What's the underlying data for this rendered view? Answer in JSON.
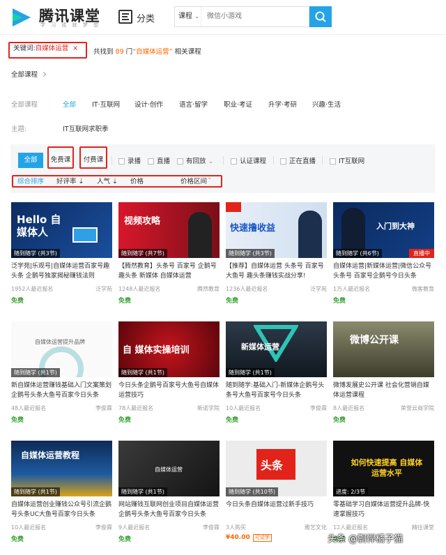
{
  "header": {
    "brand": "腾讯课堂",
    "slogan": "学 习 成 就 梦 想",
    "category_label": "分类",
    "search_type": "课程",
    "search_placeholder": "微信小游戏"
  },
  "keyword_chip": {
    "prefix": "关键词:",
    "value": "自媒体运营",
    "close": "×"
  },
  "result": {
    "pre": "共找到",
    "count": "89",
    "mid": "门",
    "query": "“自媒体运营”",
    "post": "相关课程"
  },
  "all_courses": "全部课程",
  "filters": {
    "category_key": "全部课程",
    "categories": [
      "全部",
      "IT·互联网",
      "设计·创作",
      "语言·留学",
      "职业·考证",
      "升学·考研",
      "兴趣·生活"
    ],
    "topic_key": "主题:",
    "topic_value": "IT互联网求职季"
  },
  "price_tabs": [
    "全部",
    "免费课",
    "付费课"
  ],
  "checkboxes": [
    "录播",
    "直播",
    "有回放",
    "认证课程",
    "正在直播",
    "IT互联网"
  ],
  "sort": [
    "综合排序",
    "好评率 ⇣",
    "人气 ⇣",
    "价格",
    "价格区间"
  ],
  "courses": [
    {
      "thumb": "Hello 自媒体人",
      "tag": "随到随学 (共3节)",
      "name": "泛学苑|乐观号|自媒体运营百家号趣头条 企鹅号独家揭秘赚钱法则",
      "count": "1952人最近报名",
      "org": "泛学苑",
      "price": "免费",
      "live": ""
    },
    {
      "thumb": "视频攻略",
      "tag": "随到随学 (共7节)",
      "name": "【腾然教育】头条号 百家号 企鹅号 趣头条 新媒体 自媒体运营",
      "count": "1248人最近报名",
      "org": "腾然教育",
      "price": "免费",
      "live": ""
    },
    {
      "thumb": "快速撸收益",
      "tag": "随到随学 (共3节)",
      "name": "【推荐】自媒体运营 头条号 百家号 大鱼号 趣头条赚钱实战分享!",
      "count": "1236人最近报名",
      "org": "泛学苑",
      "price": "免费",
      "live": ""
    },
    {
      "thumb": "入门到大神",
      "tag": "随到随学 (共6节)",
      "name": "自媒体运营|新媒体运营|微信公众号 头条号 百家号企鹅号今日头条",
      "count": "1万人最近报名",
      "org": "微客教育",
      "price": "免费",
      "live": "直播中"
    },
    {
      "thumb": "自媒体运营提升品牌",
      "tag": "随到随学 (共1节)",
      "name": "新自媒体运营赚钱基础入门文案策划企鹅号头条大鱼号百家今日头条",
      "count": "48人最近报名",
      "org": "李俊霖",
      "price": "免费",
      "live": ""
    },
    {
      "thumb": "自 媒体实操培训",
      "tag": "随到随学 (共1节)",
      "name": "今日头条企鹅号百家号大鱼号自媒体运营技巧",
      "count": "78人最近报名",
      "org": "新诺学院",
      "price": "免费",
      "live": ""
    },
    {
      "thumb": "新媒体运营",
      "tag": "随到随学 (共1节)",
      "name": "随到随学:基础入门-新媒体企鹅号头条号大鱼号百家号今日头条",
      "count": "10人最近报名",
      "org": "李俊霖",
      "price": "免费",
      "live": ""
    },
    {
      "thumb": "微博公开课",
      "tag": "",
      "name": "微博发展史公开课 社会化营销自媒体运营课程",
      "count": "8人最近报名",
      "org": "荣誉云商学院",
      "price": "免费",
      "live": ""
    },
    {
      "thumb": "自媒体运营教程",
      "tag": "随到随学 (共1节)",
      "name": "自媒体运营创业赚钱公众号引流企鹅号头条UC大鱼号百家今日头条",
      "count": "10人最近报名",
      "org": "李俊霖",
      "price": "免费",
      "live": ""
    },
    {
      "thumb": "自媒体运营",
      "tag": "随到随学 (共1节)",
      "name": "网站赚钱互联网创业项目自媒体运营企鹅号头条大鱼号百家今日头条",
      "count": "9人最近报名",
      "org": "李俊霖",
      "price": "免费",
      "live": ""
    },
    {
      "thumb": "头条",
      "tag": "随到随学 (共10节)",
      "name": "今日头条自媒体运营过新手技巧",
      "count": "3人购买",
      "org": "雅艺文化",
      "price": "¥40.00",
      "live": "",
      "trial": "可试学"
    },
    {
      "thumb": "如何快速提高 自媒体运营水平",
      "tag": "进度: 2/3节",
      "name": "零基础学习自媒体运营提升品牌-快速掌握技巧",
      "count": "12人最近报名",
      "org": "精往课堂",
      "price": "免费",
      "live": ""
    }
  ],
  "watermark": "头条 @剽悍橘子猫"
}
